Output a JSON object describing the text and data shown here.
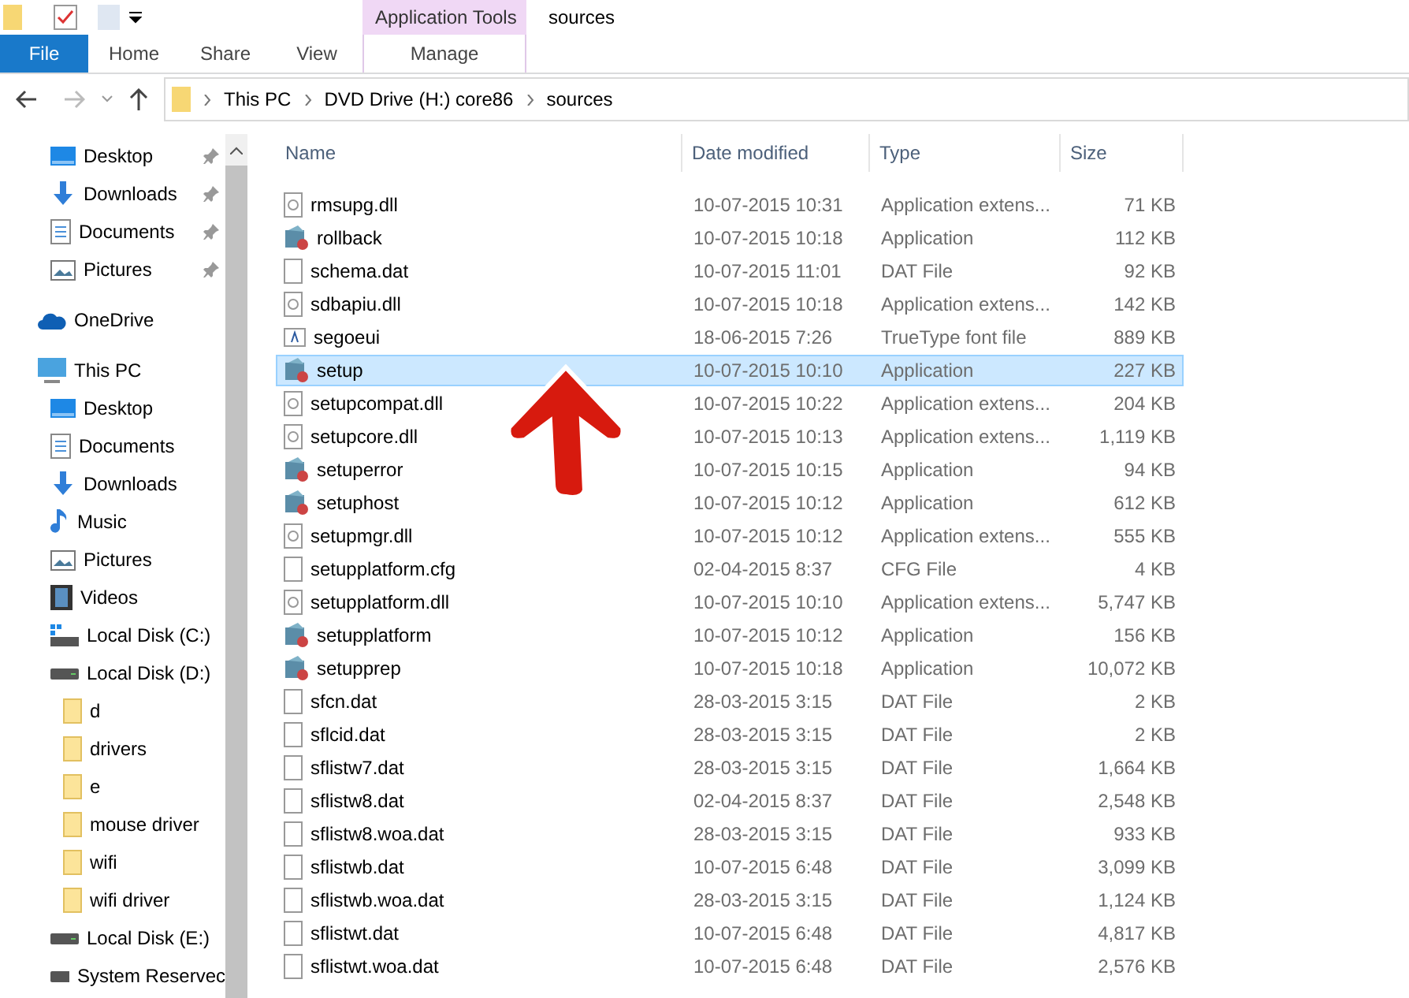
{
  "ribbon": {
    "context_group": "Application Tools",
    "window_title": "sources",
    "tabs": [
      {
        "label": "File",
        "kind": "file"
      },
      {
        "label": "Home",
        "kind": "tab"
      },
      {
        "label": "Share",
        "kind": "tab"
      },
      {
        "label": "View",
        "kind": "tab"
      },
      {
        "label": "Manage",
        "kind": "context"
      }
    ]
  },
  "address": {
    "crumbs": [
      "This PC",
      "DVD Drive (H:) core86",
      "sources"
    ]
  },
  "sidebar": {
    "items": [
      {
        "label": "Desktop",
        "kind": "desktop",
        "pinned": true
      },
      {
        "label": "Downloads",
        "kind": "downloads",
        "pinned": true
      },
      {
        "label": "Documents",
        "kind": "documents",
        "pinned": true
      },
      {
        "label": "Pictures",
        "kind": "pictures",
        "pinned": true
      },
      {
        "label": "OneDrive",
        "kind": "onedrive",
        "pinned": false
      },
      {
        "label": "This PC",
        "kind": "pc",
        "pinned": false,
        "children": [
          {
            "label": "Desktop",
            "kind": "desktop",
            "pinned": false
          },
          {
            "label": "Documents",
            "kind": "documents",
            "pinned": false
          },
          {
            "label": "Downloads",
            "kind": "downloads",
            "pinned": false
          },
          {
            "label": "Music",
            "kind": "music",
            "pinned": false
          },
          {
            "label": "Pictures",
            "kind": "pictures",
            "pinned": false
          },
          {
            "label": "Videos",
            "kind": "videos",
            "pinned": false
          },
          {
            "label": "Local Disk (C:)",
            "kind": "sysdisk",
            "pinned": false
          },
          {
            "label": "Local Disk (D:)",
            "kind": "disk",
            "pinned": false,
            "children": [
              {
                "label": "d",
                "kind": "folder",
                "pinned": false
              },
              {
                "label": "drivers",
                "kind": "folder",
                "pinned": false
              },
              {
                "label": "e",
                "kind": "folder",
                "pinned": false
              },
              {
                "label": "mouse driver",
                "kind": "folder",
                "pinned": false
              },
              {
                "label": "wifi",
                "kind": "folder",
                "pinned": false
              },
              {
                "label": "wifi driver",
                "kind": "folder",
                "pinned": false
              }
            ]
          },
          {
            "label": "Local Disk (E:)",
            "kind": "disk",
            "pinned": false
          },
          {
            "label": "System Reservec",
            "kind": "disk",
            "pinned": false
          }
        ]
      }
    ]
  },
  "table": {
    "columns": [
      "Name",
      "Date modified",
      "Type",
      "Size"
    ],
    "rows": [
      {
        "name": "rmsupg.dll",
        "date": "10-07-2015 10:31",
        "type": "Application extens...",
        "size": "71 KB",
        "kind": "dll",
        "selected": false
      },
      {
        "name": "rollback",
        "date": "10-07-2015 10:18",
        "type": "Application",
        "size": "112 KB",
        "kind": "app",
        "selected": false
      },
      {
        "name": "schema.dat",
        "date": "10-07-2015 11:01",
        "type": "DAT File",
        "size": "92 KB",
        "kind": "file",
        "selected": false
      },
      {
        "name": "sdbapiu.dll",
        "date": "10-07-2015 10:18",
        "type": "Application extens...",
        "size": "142 KB",
        "kind": "dll",
        "selected": false
      },
      {
        "name": "segoeui",
        "date": "18-06-2015 7:26",
        "type": "TrueType font file",
        "size": "889 KB",
        "kind": "font",
        "selected": false
      },
      {
        "name": "setup",
        "date": "10-07-2015 10:10",
        "type": "Application",
        "size": "227 KB",
        "kind": "app",
        "selected": true
      },
      {
        "name": "setupcompat.dll",
        "date": "10-07-2015 10:22",
        "type": "Application extens...",
        "size": "204 KB",
        "kind": "dll",
        "selected": false
      },
      {
        "name": "setupcore.dll",
        "date": "10-07-2015 10:13",
        "type": "Application extens...",
        "size": "1,119 KB",
        "kind": "dll",
        "selected": false
      },
      {
        "name": "setuperror",
        "date": "10-07-2015 10:15",
        "type": "Application",
        "size": "94 KB",
        "kind": "app",
        "selected": false
      },
      {
        "name": "setuphost",
        "date": "10-07-2015 10:12",
        "type": "Application",
        "size": "612 KB",
        "kind": "app",
        "selected": false
      },
      {
        "name": "setupmgr.dll",
        "date": "10-07-2015 10:12",
        "type": "Application extens...",
        "size": "555 KB",
        "kind": "dll",
        "selected": false
      },
      {
        "name": "setupplatform.cfg",
        "date": "02-04-2015 8:37",
        "type": "CFG File",
        "size": "4 KB",
        "kind": "file",
        "selected": false
      },
      {
        "name": "setupplatform.dll",
        "date": "10-07-2015 10:10",
        "type": "Application extens...",
        "size": "5,747 KB",
        "kind": "dll",
        "selected": false
      },
      {
        "name": "setupplatform",
        "date": "10-07-2015 10:12",
        "type": "Application",
        "size": "156 KB",
        "kind": "app",
        "selected": false
      },
      {
        "name": "setupprep",
        "date": "10-07-2015 10:18",
        "type": "Application",
        "size": "10,072 KB",
        "kind": "app",
        "selected": false
      },
      {
        "name": "sfcn.dat",
        "date": "28-03-2015 3:15",
        "type": "DAT File",
        "size": "2 KB",
        "kind": "file",
        "selected": false
      },
      {
        "name": "sflcid.dat",
        "date": "28-03-2015 3:15",
        "type": "DAT File",
        "size": "2 KB",
        "kind": "file",
        "selected": false
      },
      {
        "name": "sflistw7.dat",
        "date": "28-03-2015 3:15",
        "type": "DAT File",
        "size": "1,664 KB",
        "kind": "file",
        "selected": false
      },
      {
        "name": "sflistw8.dat",
        "date": "02-04-2015 8:37",
        "type": "DAT File",
        "size": "2,548 KB",
        "kind": "file",
        "selected": false
      },
      {
        "name": "sflistw8.woa.dat",
        "date": "28-03-2015 3:15",
        "type": "DAT File",
        "size": "933 KB",
        "kind": "file",
        "selected": false
      },
      {
        "name": "sflistwb.dat",
        "date": "10-07-2015 6:48",
        "type": "DAT File",
        "size": "3,099 KB",
        "kind": "file",
        "selected": false
      },
      {
        "name": "sflistwb.woa.dat",
        "date": "28-03-2015 3:15",
        "type": "DAT File",
        "size": "1,124 KB",
        "kind": "file",
        "selected": false
      },
      {
        "name": "sflistwt.dat",
        "date": "10-07-2015 6:48",
        "type": "DAT File",
        "size": "4,817 KB",
        "kind": "file",
        "selected": false
      },
      {
        "name": "sflistwt.woa.dat",
        "date": "10-07-2015 6:48",
        "type": "DAT File",
        "size": "2,576 KB",
        "kind": "file",
        "selected": false
      }
    ]
  }
}
